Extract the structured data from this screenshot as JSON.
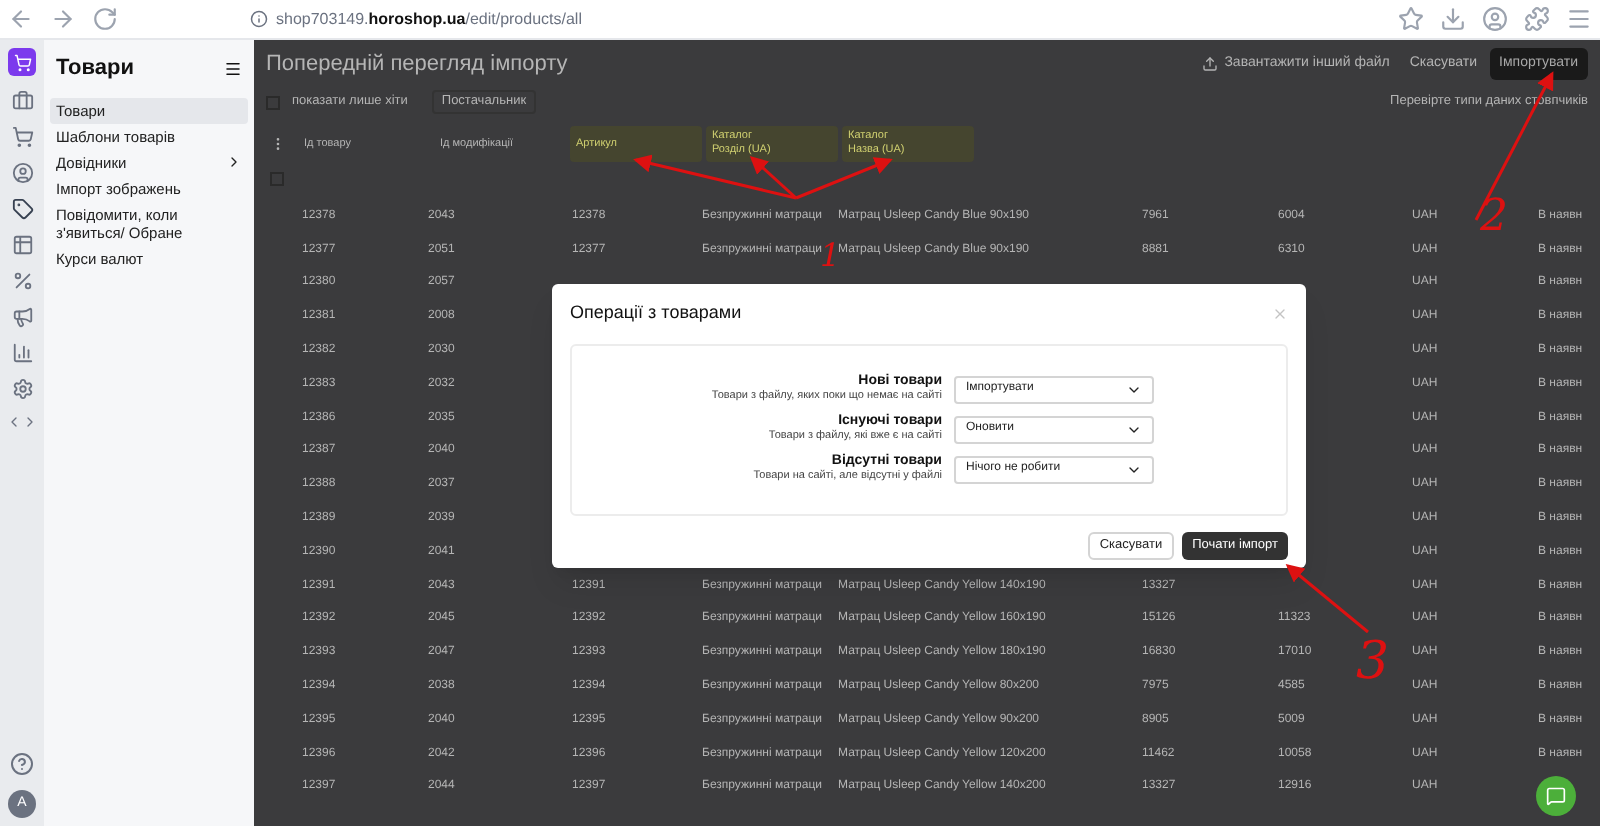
{
  "browser": {
    "url_host_prefix": "shop703149.",
    "url_host": "horoshop.ua",
    "url_path": "/edit/products/all"
  },
  "sidebar": {
    "title": "Товари",
    "items": [
      {
        "label": "Товари",
        "selected": true,
        "has_children": false
      },
      {
        "label": "Шаблони товарів",
        "selected": false,
        "has_children": false
      },
      {
        "label": "Довідники",
        "selected": false,
        "has_children": true
      },
      {
        "label": "Імпорт зображень",
        "selected": false,
        "has_children": false
      },
      {
        "label": "Повідомити, коли з'явиться/ Обране",
        "selected": false,
        "has_children": false
      },
      {
        "label": "Курси валют",
        "selected": false,
        "has_children": false
      }
    ],
    "avatar": "A"
  },
  "page": {
    "title": "Попередній перегляд імпорту",
    "actions": [
      {
        "label": "Завантажити інший файл",
        "kind": "link"
      },
      {
        "label": "Скасувати",
        "kind": "plain"
      },
      {
        "label": "Імпортувати",
        "kind": "primary"
      }
    ],
    "filter_checkbox": {
      "label": "показати лише хіти",
      "checked": false
    },
    "filter_select": "Постачальник",
    "hint": "Перевірте типи даних стовпчиків"
  },
  "table": {
    "select_all": {
      "checked": false
    },
    "mapping": [
      {
        "label": "Ід товару",
        "highlighted": false
      },
      {
        "label": "Ід модифікації",
        "highlighted": false
      },
      {
        "label": "Артикул",
        "highlighted": true
      },
      {
        "label": "Каталог",
        "sub": "Розділ (UA)",
        "highlighted": true
      },
      {
        "label": "Каталог",
        "sub": "Назва (UA)",
        "highlighted": true
      }
    ],
    "rows": [
      {
        "column_1": "12378",
        "column_2": "2043",
        "column_3": "12378",
        "column_4": "Безпружинні матраци",
        "column_5": "Матрац Usleep Candy Blue 90x190",
        "column_6": "7961",
        "column_7": "6004",
        "column_8": "UAH",
        "column_9": "В наявн"
      },
      {
        "column_1": "12377",
        "column_2": "2051",
        "column_3": "12377",
        "column_4": "Безпружинні матраци",
        "column_5": "Матрац Usleep Candy Blue 90x190",
        "column_6": "8881",
        "column_7": "6310",
        "column_8": "UAH",
        "column_9": "В наявн"
      },
      {
        "column_1": "12380",
        "column_2": "2057",
        "column_8": "UAH",
        "column_9": "В наявн"
      },
      {
        "column_1": "12381",
        "column_2": "2008",
        "column_8": "UAH",
        "column_9": "В наявн"
      },
      {
        "column_1": "12382",
        "column_2": "2030",
        "column_8": "UAH",
        "column_9": "В наявн"
      },
      {
        "column_1": "12383",
        "column_2": "2032",
        "column_8": "UAH",
        "column_9": "В наявн"
      },
      {
        "column_1": "12386",
        "column_2": "2035",
        "column_8": "UAH",
        "column_9": "В наявн"
      },
      {
        "column_1": "12387",
        "column_2": "2040",
        "column_8": "UAH",
        "column_9": "В наявн"
      },
      {
        "column_1": "12388",
        "column_2": "2037",
        "column_8": "UAH",
        "column_9": "В наявн"
      },
      {
        "column_1": "12389",
        "column_2": "2039",
        "column_8": "UAH",
        "column_9": "В наявн"
      },
      {
        "column_1": "12390",
        "column_2": "2041",
        "column_8": "UAH",
        "column_9": "В наявн"
      },
      {
        "column_1": "12391",
        "column_2": "2043",
        "column_3": "12391",
        "column_4": "Безпружинні матраци",
        "column_5": "Матрац Usleep Candy Yellow 140x190",
        "column_6": "13327",
        "column_8": "UAH",
        "column_9": "В наявн"
      },
      {
        "column_1": "12392",
        "column_2": "2045",
        "column_3": "12392",
        "column_4": "Безпружинні матраци",
        "column_5": "Матрац Usleep Candy Yellow 160x190",
        "column_6": "15126",
        "column_7": "11323",
        "column_8": "UAH",
        "column_9": "В наявн"
      },
      {
        "column_1": "12393",
        "column_2": "2047",
        "column_3": "12393",
        "column_4": "Безпружинні матраци",
        "column_5": "Матрац Usleep Candy Yellow 180x190",
        "column_6": "16830",
        "column_7": "17010",
        "column_8": "UAH",
        "column_9": "В наявн"
      },
      {
        "column_1": "12394",
        "column_2": "2038",
        "column_3": "12394",
        "column_4": "Безпружинні матраци",
        "column_5": "Матрац Usleep Candy Yellow 80x200",
        "column_6": "7975",
        "column_7": "4585",
        "column_8": "UAH",
        "column_9": "В наявн"
      },
      {
        "column_1": "12395",
        "column_2": "2040",
        "column_3": "12395",
        "column_4": "Безпружинні матраци",
        "column_5": "Матрац Usleep Candy Yellow 90x200",
        "column_6": "8905",
        "column_7": "5009",
        "column_8": "UAH",
        "column_9": "В наявн"
      },
      {
        "column_1": "12396",
        "column_2": "2042",
        "column_3": "12396",
        "column_4": "Безпружинні матраци",
        "column_5": "Матрац Usleep Candy Yellow 120x200",
        "column_6": "11462",
        "column_7": "10058",
        "column_8": "UAH",
        "column_9": "В наявн"
      },
      {
        "column_1": "12397",
        "column_2": "2044",
        "column_3": "12397",
        "column_4": "Безпружинні матраци",
        "column_5": "Матрац Usleep Candy Yellow 140x200",
        "column_6": "13327",
        "column_7": "12916",
        "column_8": "UAH"
      }
    ]
  },
  "dialog": {
    "title": "Операції з товарами",
    "operations": [
      {
        "label": "Нові товари",
        "description": "Товари з файлу, яких поки що немає на сайті",
        "value": "Імпортувати"
      },
      {
        "label": "Існуючі товари",
        "description": "Товари з файлу, які вже є на сайті",
        "value": "Оновити"
      },
      {
        "label": "Відсутні товари",
        "description": "Товари на сайті, але відсутні у файлі",
        "value": "Нічого не робити"
      }
    ],
    "buttons": [
      {
        "label": "Скасувати",
        "kind": "secondary"
      },
      {
        "label": "Почати імпорт",
        "kind": "primary"
      }
    ]
  },
  "annotations": [
    "1",
    "2",
    "3"
  ]
}
